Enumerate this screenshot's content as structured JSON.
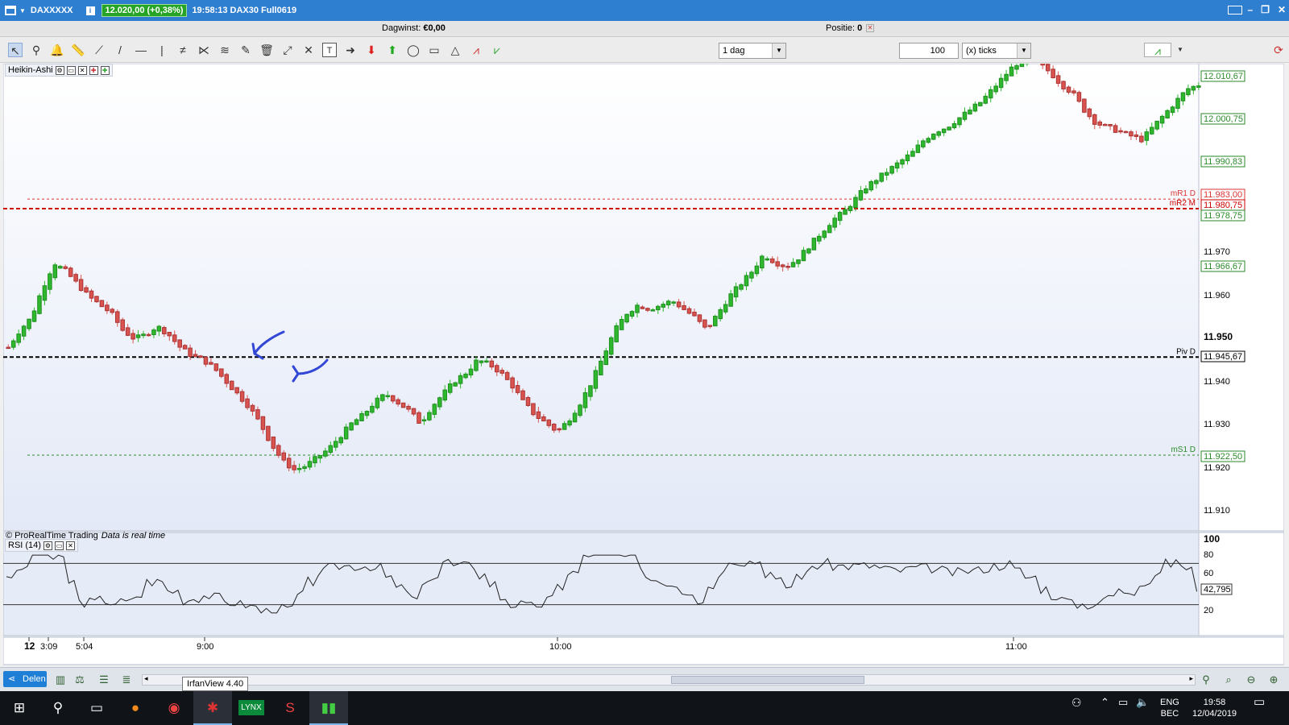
{
  "titlebar": {
    "instrument": "DAXXXXX",
    "info_icon": "info-icon",
    "price": "12.020,00 (+0,38%)",
    "time_desc": "19:58:13 DAX30 Full0619",
    "price_color": "#25a425",
    "bar_color": "#2f7fd1"
  },
  "infobar": {
    "gain_label": "Dagwinst:",
    "gain_value": "€0,00",
    "position_label": "Positie:",
    "position_value": "0"
  },
  "toolbar": {
    "timeframe": "1 dag",
    "units_value": "100",
    "units_type": "(x) ticks"
  },
  "chart": {
    "panel_title": "Heikin-Ashi",
    "rsi_title": "RSI (14)",
    "copyright": "© ProRealTime Trading",
    "realtime_note": "Data is real time",
    "price_axis": [
      "12.010,67",
      "12.000,75",
      "11.990,83",
      "11.983,00",
      "11.980,75",
      "11.978,75",
      "11.970",
      "11.966,67",
      "11.960",
      "11.950",
      "11.945,67",
      "11.940",
      "11.930",
      "11.922,50",
      "11.920",
      "11.910"
    ],
    "level_labels": {
      "mr1": "mR1 D",
      "mr2": "mR2 M",
      "piv": "Piv D",
      "ms1": "mS1 D"
    },
    "rsi_axis": [
      "100",
      "80",
      "60",
      "42,795",
      "20"
    ],
    "time_axis": [
      "12",
      "3:09",
      "5:04",
      "9:00",
      "10:00",
      "11:00"
    ],
    "colors": {
      "up": "#2eb82e",
      "down": "#d9534f",
      "annotation": "#3347d6"
    }
  },
  "chart_data": {
    "type": "candlestick",
    "style": "Heikin-Ashi",
    "instrument": "DAX30 Full0619",
    "y_range": [
      11905,
      12015
    ],
    "levels": [
      {
        "name": "mR1 D",
        "value": 11983.0
      },
      {
        "name": "mR2 M",
        "value": 11980.75
      },
      {
        "name": "Piv D",
        "value": 11945.67
      },
      {
        "name": "mS1 D",
        "value": 11922.5
      }
    ],
    "close_path": [
      11948,
      11952,
      11955,
      11962,
      11968,
      11966,
      11963,
      11960,
      11958,
      11956,
      11952,
      11950,
      11951,
      11953,
      11951,
      11948,
      11946,
      11945,
      11943,
      11940,
      11937,
      11934,
      11930,
      11925,
      11921,
      11919,
      11920,
      11922,
      11924,
      11927,
      11930,
      11932,
      11935,
      11937,
      11935,
      11933,
      11930,
      11934,
      11937,
      11940,
      11942,
      11945,
      11944,
      11942,
      11939,
      11935,
      11932,
      11930,
      11928,
      11931,
      11935,
      11940,
      11946,
      11952,
      11956,
      11958,
      11957,
      11958,
      11959,
      11957,
      11955,
      11952,
      11956,
      11960,
      11963,
      11966,
      11970,
      11968,
      11967,
      11969,
      11972,
      11975,
      11978,
      11980,
      11983,
      11986,
      11988,
      11990,
      11992,
      11994,
      11997,
      11999,
      12000,
      12002,
      12004,
      12006,
      12009,
      12012,
      12015,
      12015,
      12015,
      12013,
      12010,
      12008,
      12004,
      12001,
      12000,
      11999,
      11998,
      11997,
      12000,
      12003,
      12006,
      12009,
      12010
    ],
    "rsi": {
      "value": 42.795,
      "levels": [
        70,
        30
      ],
      "y_range": [
        0,
        100
      ]
    }
  }
}
